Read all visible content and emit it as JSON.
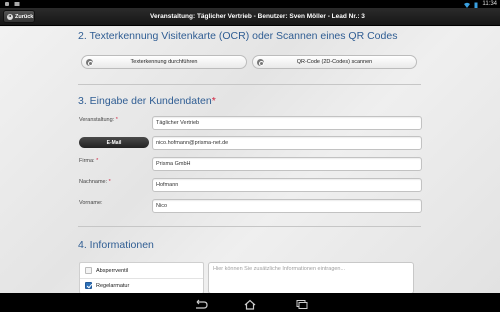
{
  "status_bar": {
    "time": "11:34",
    "icons": [
      "android-debug-icon",
      "media-icon",
      "wifi-icon",
      "battery-icon"
    ]
  },
  "header": {
    "back_label": "Zurück",
    "title": "Veranstaltung: Täglicher Vertrieb - Benutzer: Sven Möller - Lead Nr.: 3"
  },
  "section2": {
    "title": "2. Texterkennung Visitenkarte (OCR) oder Scannen eines QR Codes",
    "ocr_button": "Texterkennung durchführen",
    "qr_button": "QR-Code (2D-Codes) scannen"
  },
  "section3": {
    "title": "3. Eingabe der Kundendaten",
    "required_mark": "*",
    "fields": [
      {
        "label": "Veranstaltung:",
        "required": "*",
        "value": "Täglicher Vertrieb"
      },
      {
        "label": "E-Mail",
        "required": "",
        "value": "nico.hofmann@prisma-net.de"
      },
      {
        "label": "Firma:",
        "required": "*",
        "value": "Prisma GmbH"
      },
      {
        "label": "Nachname:",
        "required": "*",
        "value": "Hofmann"
      },
      {
        "label": "Vorname:",
        "required": "",
        "value": "Nico"
      }
    ]
  },
  "section4": {
    "title": "4. Informationen",
    "options": [
      {
        "label": "Absperrventil",
        "checked": false
      },
      {
        "label": "Regelarmatur",
        "checked": true
      }
    ],
    "textarea_placeholder": "Hier können Sie zusätzliche Informationen eintragen..."
  },
  "colors": {
    "section_title": "#2f5d93",
    "required": "#d0233f",
    "checkbox_checked": "#2c6fb6"
  },
  "nav_bar": {
    "buttons": [
      "back-nav-icon",
      "home-nav-icon",
      "recent-apps-icon"
    ]
  }
}
